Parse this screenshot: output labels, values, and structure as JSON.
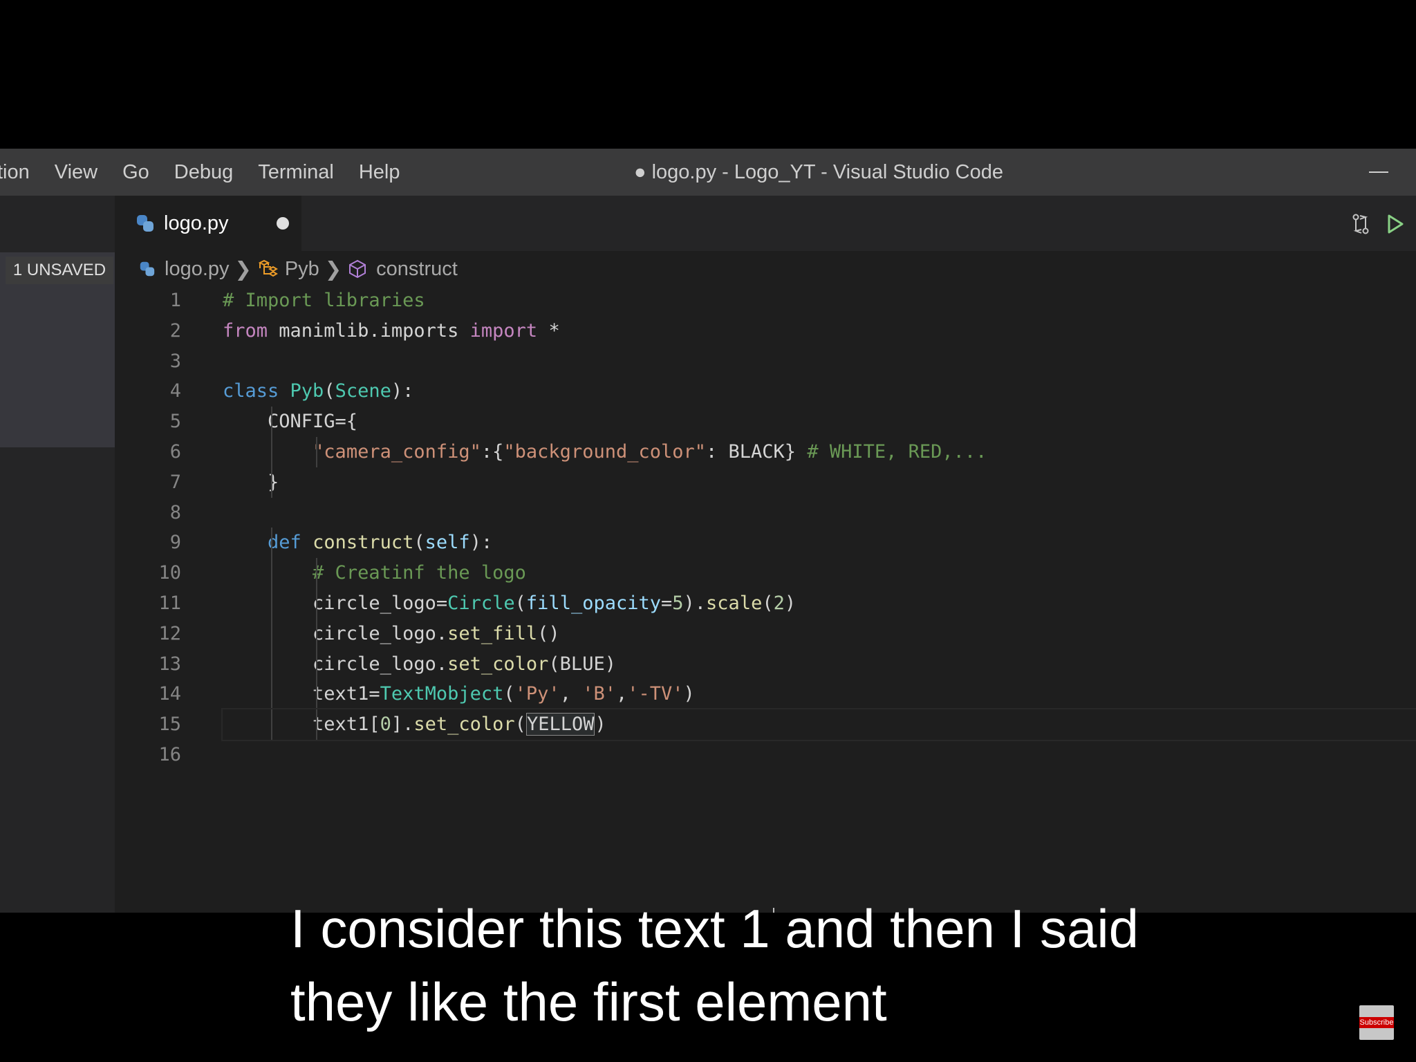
{
  "window": {
    "title": "● logo.py - Logo_YT - Visual Studio Code"
  },
  "menu": {
    "items": [
      "tion",
      "View",
      "Go",
      "Debug",
      "Terminal",
      "Help"
    ]
  },
  "tab": {
    "label": "logo.py",
    "dirty": true
  },
  "sidebar": {
    "unsaved_label": "1 UNSAVED"
  },
  "breadcrumb": {
    "file": "logo.py",
    "class": "Pyb",
    "method": "construct"
  },
  "editor": {
    "line_numbers": [
      "1",
      "2",
      "3",
      "4",
      "5",
      "6",
      "7",
      "8",
      "9",
      "10",
      "11",
      "12",
      "13",
      "14",
      "15",
      "16"
    ],
    "current_line": 15
  },
  "icons": {
    "file": "python-icon",
    "class": "class-icon",
    "method": "method-cube-icon",
    "compare": "compare-changes-icon",
    "run": "run-play-icon"
  },
  "subtitle": {
    "line1": "I consider this text 1 and then I said",
    "line2": "they like the first element"
  },
  "badge": {
    "label": "Subscribe"
  },
  "colors": {
    "titlebar_bg": "#3a3a3b",
    "editor_bg": "#1e1e1e",
    "sidebar_bg": "#252526",
    "keyword": "#c586c0",
    "comment": "#6a9955",
    "string": "#ce9178",
    "class": "#4ec9b0",
    "function": "#dcdcaa",
    "run_green": "#89d185"
  }
}
